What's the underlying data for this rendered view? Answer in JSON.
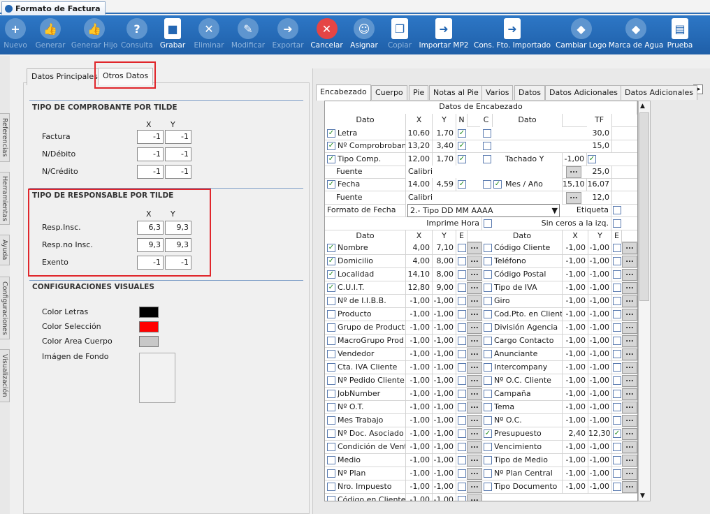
{
  "window": {
    "title": "Formato de Factura"
  },
  "toolbar": [
    {
      "label": "Nuevo",
      "icon": "new-doc-icon",
      "enabled": false,
      "w": 44
    },
    {
      "label": "Generar",
      "icon": "thumb-icon",
      "enabled": false,
      "w": 56
    },
    {
      "label": "Generar Hijo",
      "icon": "thumb-icon",
      "enabled": false,
      "w": 70
    },
    {
      "label": "Consulta",
      "icon": "query-icon",
      "enabled": false,
      "w": 52
    },
    {
      "label": "Grabar",
      "icon": "save-icon",
      "enabled": true,
      "w": 50
    },
    {
      "label": "Eliminar",
      "icon": "delete-doc-icon",
      "enabled": false,
      "w": 54
    },
    {
      "label": "Modificar",
      "icon": "edit-icon",
      "enabled": false,
      "w": 58
    },
    {
      "label": "Exportar",
      "icon": "export-icon",
      "enabled": false,
      "w": 56
    },
    {
      "label": "Cancelar",
      "icon": "cancel-icon",
      "enabled": true,
      "w": 55
    },
    {
      "label": "Asignar",
      "icon": "assign-icon",
      "enabled": true,
      "w": 52
    },
    {
      "label": "Copiar",
      "icon": "copy-icon",
      "enabled": false,
      "w": 50
    },
    {
      "label": "Importar MP2",
      "icon": "import-icon",
      "enabled": true,
      "w": 76
    },
    {
      "label": "Cons. Fto. Importado",
      "icon": "import-icon",
      "enabled": true,
      "w": 120
    },
    {
      "label": "Cambiar Logo",
      "icon": "logo-icon",
      "enabled": true,
      "w": 77
    },
    {
      "label": "Marca de Agua",
      "icon": "logo-icon",
      "enabled": true,
      "w": 80
    },
    {
      "label": "Prueba",
      "icon": "print-icon",
      "enabled": true,
      "w": 46
    }
  ],
  "side_tabs": [
    "Referencias",
    "Herramientas",
    "Ayuda",
    "Configuraciones",
    "Visualización"
  ],
  "left": {
    "tabs": [
      "Datos Principales",
      "Otros Datos"
    ],
    "sec1": {
      "title": "TIPO DE COMPROBANTE POR TILDE",
      "x": "X",
      "y": "Y",
      "rows": [
        {
          "label": "Factura",
          "x": "-1",
          "y": "-1"
        },
        {
          "label": "N/Débito",
          "x": "-1",
          "y": "-1"
        },
        {
          "label": "N/Crédito",
          "x": "-1",
          "y": "-1"
        }
      ]
    },
    "sec2": {
      "title": "TIPO DE RESPONSABLE POR TILDE",
      "x": "X",
      "y": "Y",
      "rows": [
        {
          "label": "Resp.Insc.",
          "x": "6,3",
          "y": "9,3"
        },
        {
          "label": "Resp.no Insc.",
          "x": "9,3",
          "y": "9,3"
        },
        {
          "label": "Exento",
          "x": "-1",
          "y": "-1"
        }
      ]
    },
    "sec3": {
      "title": "CONFIGURACIONES VISUALES",
      "items": [
        {
          "label": "Color Letras",
          "color": "#000000"
        },
        {
          "label": "Color Selección",
          "color": "#ff0000"
        },
        {
          "label": "Color Area Cuerpo",
          "color": "#c8c8c8"
        }
      ],
      "image_label": "Imágen de Fondo"
    }
  },
  "right": {
    "tabs": [
      "Encabezado",
      "Cuerpo",
      "Pie",
      "Notas al Pie",
      "Varios",
      "Datos",
      "Datos Adicionales",
      "Datos Adicionales"
    ],
    "header_title": "Datos de Encabezado",
    "top_cols": {
      "dato": "Dato",
      "x": "X",
      "y": "Y",
      "n": "N",
      "c": "C",
      "dato2": "Dato",
      "tf": "TF"
    },
    "top_rows": [
      {
        "chk": true,
        "label": "Letra",
        "x": "10,60",
        "y": "1,70",
        "n": true,
        "c": false,
        "d2": "",
        "tf": "30,0"
      },
      {
        "chk": true,
        "label": "Nº Comprobrobante",
        "x": "13,20",
        "y": "3,40",
        "n": true,
        "c": false,
        "d2": "",
        "tf": "15,0"
      },
      {
        "chk": true,
        "label": "Tipo Comp.",
        "x": "12,00",
        "y": "1,70",
        "n": true,
        "c": false,
        "d2": "Tachado Y",
        "d2val": "-1,00",
        "d2chk": true,
        "tf": ""
      },
      {
        "font": true,
        "label": "Fuente",
        "value": "Calibri",
        "tf": "25,0"
      },
      {
        "chk": true,
        "label": "Fecha",
        "x": "14,00",
        "y": "4,59",
        "n": true,
        "c": false,
        "c2": true,
        "d2": "Mes / Año",
        "d2val": "15,10",
        "tf": "16,07"
      },
      {
        "font": true,
        "label": "Fuente",
        "value": "Calibri",
        "tf": "12,0"
      }
    ],
    "fecha_label": "Formato de Fecha",
    "fecha_value": "2.- Tipo DD MM AAAA",
    "etiqueta": "Etiqueta",
    "imprime_hora": "Imprime Hora",
    "sin_ceros": "Sin ceros a la izq.",
    "cols": {
      "dato": "Dato",
      "x": "X",
      "y": "Y",
      "e": "E"
    },
    "rows": [
      {
        "l": "Nombre",
        "lc": true,
        "lx": "4,00",
        "ly": "7,10",
        "r": "Código Cliente",
        "rc": false,
        "rx": "-1,00",
        "ry": "-1,00"
      },
      {
        "l": "Domicilio",
        "lc": true,
        "lx": "4,00",
        "ly": "8,00",
        "r": "Teléfono",
        "rc": false,
        "rx": "-1,00",
        "ry": "-1,00"
      },
      {
        "l": "Localidad",
        "lc": true,
        "lx": "14,10",
        "ly": "8,00",
        "r": "Código Postal",
        "rc": false,
        "rx": "-1,00",
        "ry": "-1,00"
      },
      {
        "l": "C.U.I.T.",
        "lc": true,
        "lx": "12,80",
        "ly": "9,00",
        "r": "Tipo de IVA",
        "rc": false,
        "rx": "-1,00",
        "ry": "-1,00"
      },
      {
        "l": "Nº de I.I.B.B.",
        "lc": false,
        "lx": "-1,00",
        "ly": "-1,00",
        "r": "Giro",
        "rc": false,
        "rx": "-1,00",
        "ry": "-1,00"
      },
      {
        "l": "Producto",
        "lc": false,
        "lx": "-1,00",
        "ly": "-1,00",
        "r": "Cod.Pto. en Cliente",
        "rc": false,
        "rx": "-1,00",
        "ry": "-1,00"
      },
      {
        "l": "Grupo de Producto",
        "lc": false,
        "lx": "-1,00",
        "ly": "-1,00",
        "r": "División Agencia",
        "rc": false,
        "rx": "-1,00",
        "ry": "-1,00"
      },
      {
        "l": "MacroGrupo Prod",
        "lc": false,
        "lx": "-1,00",
        "ly": "-1,00",
        "r": "Cargo Contacto",
        "rc": false,
        "rx": "-1,00",
        "ry": "-1,00"
      },
      {
        "l": "Vendedor",
        "lc": false,
        "lx": "-1,00",
        "ly": "-1,00",
        "r": "Anunciante",
        "rc": false,
        "rx": "-1,00",
        "ry": "-1,00"
      },
      {
        "l": "Cta. IVA Cliente",
        "lc": false,
        "lx": "-1,00",
        "ly": "-1,00",
        "r": "Intercompany",
        "rc": false,
        "rx": "-1,00",
        "ry": "-1,00"
      },
      {
        "l": "Nº Pedido Cliente",
        "lc": false,
        "lx": "-1,00",
        "ly": "-1,00",
        "r": "Nº O.C. Cliente",
        "rc": false,
        "rx": "-1,00",
        "ry": "-1,00"
      },
      {
        "l": "JobNumber",
        "lc": false,
        "lx": "-1,00",
        "ly": "-1,00",
        "r": "Campaña",
        "rc": false,
        "rx": "-1,00",
        "ry": "-1,00"
      },
      {
        "l": "Nº O.T.",
        "lc": false,
        "lx": "-1,00",
        "ly": "-1,00",
        "r": "Tema",
        "rc": false,
        "rx": "-1,00",
        "ry": "-1,00"
      },
      {
        "l": "Mes Trabajo",
        "lc": false,
        "lx": "-1,00",
        "ly": "-1,00",
        "r": "Nº O.C.",
        "rc": false,
        "rx": "-1,00",
        "ry": "-1,00"
      },
      {
        "l": "Nº Doc. Asociado",
        "lc": false,
        "lx": "-1,00",
        "ly": "-1,00",
        "r": "Presupuesto",
        "rc": true,
        "rx": "2,40",
        "ry": "12,30",
        "re": true
      },
      {
        "l": "Condición de Venta",
        "lc": false,
        "lx": "-1,00",
        "ly": "-1,00",
        "r": "Vencimiento",
        "rc": false,
        "rx": "-1,00",
        "ry": "-1,00"
      },
      {
        "l": "Medio",
        "lc": false,
        "lx": "-1,00",
        "ly": "-1,00",
        "r": "Tipo de Medio",
        "rc": false,
        "rx": "-1,00",
        "ry": "-1,00"
      },
      {
        "l": "Nº Plan",
        "lc": false,
        "lx": "-1,00",
        "ly": "-1,00",
        "r": "Nº Plan Central",
        "rc": false,
        "rx": "-1,00",
        "ry": "-1,00"
      },
      {
        "l": "Nro. Impuesto",
        "lc": false,
        "lx": "-1,00",
        "ly": "-1,00",
        "r": "Tipo Documento",
        "rc": false,
        "rx": "-1,00",
        "ry": "-1,00"
      },
      {
        "l": "Código en Cliente",
        "lc": false,
        "lx": "-1,00",
        "ly": "-1,00",
        "r": "",
        "rc": false,
        "rx": "",
        "ry": ""
      }
    ],
    "dots_label": "..."
  }
}
